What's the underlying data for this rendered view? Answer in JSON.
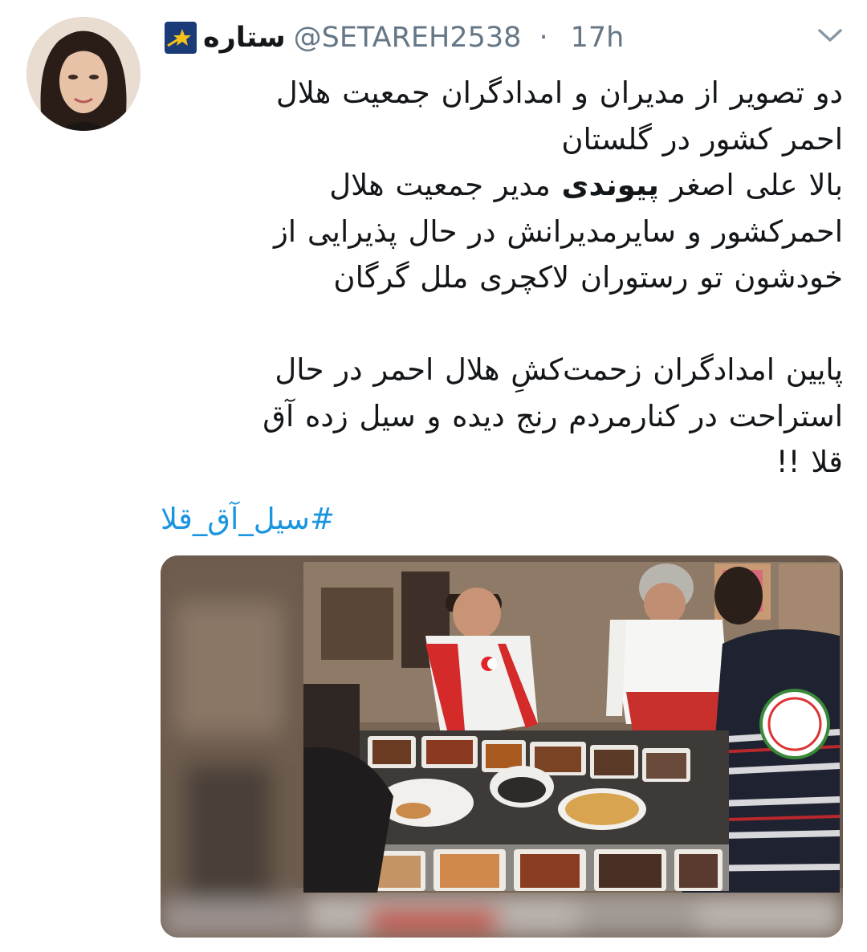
{
  "tweet": {
    "display_name": "ستاره",
    "handle": "@SETAREH2538",
    "separator": "·",
    "time": "17h",
    "text_part1": "دو تصویر از مدیران و امدادگران جمعیت هلال\nاحمر کشور در گلستان\nبالا علی اصغر ",
    "text_bold": "پیوندی",
    "text_part2": " مدیر جمعیت هلال\nاحمرکشور و سایرمدیرانش در حال پذیرایی از\nخودشون تو رستوران لاکچری ملل گرگان\n\n پایین امدادگران زحمت‌کشِ هلال احمر در حال\nاستراحت در کنارمردم رنج دیده و سیل زده آق\nقلا !!",
    "hashtag": "#سیل_آق_قلا"
  },
  "icons": {
    "badge": "star-badge-icon",
    "menu": "chevron-down-icon"
  },
  "colors": {
    "text": "#14171a",
    "muted": "#657786",
    "link": "#1b95e0",
    "crescent": "#e0242a"
  }
}
